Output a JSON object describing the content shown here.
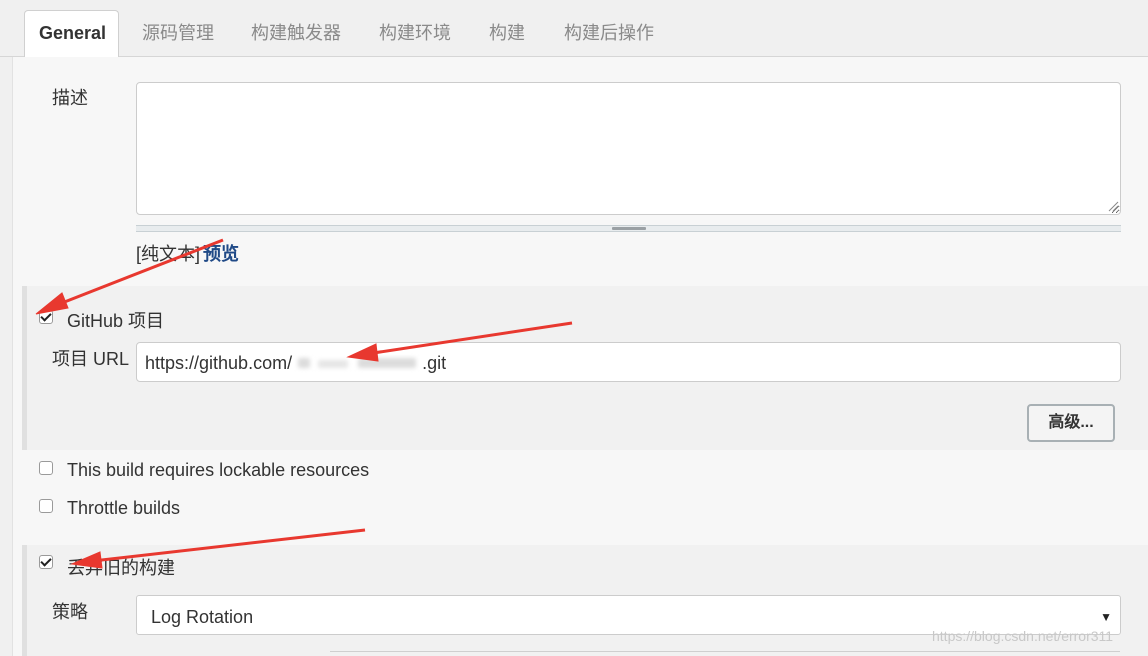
{
  "tabs": [
    {
      "label": "General",
      "active": true
    },
    {
      "label": "源码管理"
    },
    {
      "label": "构建触发器"
    },
    {
      "label": "构建环境"
    },
    {
      "label": "构建"
    },
    {
      "label": "构建后操作"
    }
  ],
  "description": {
    "label": "描述",
    "value": "",
    "plain_text": "[纯文本]",
    "preview": "预览"
  },
  "github": {
    "checkbox_label": "GitHub 项目",
    "checked": true,
    "url_label": "项目 URL",
    "url_prefix": "https://github.com/",
    "url_suffix": ".git",
    "advanced_button": "高级..."
  },
  "options": [
    {
      "label": "This build requires lockable resources",
      "checked": false
    },
    {
      "label": "Throttle builds",
      "checked": false
    },
    {
      "label": "丢弃旧的构建",
      "checked": true
    }
  ],
  "strategy": {
    "label": "策略",
    "selected": "Log Rotation",
    "arrow": "▼"
  },
  "watermark": "https://blog.csdn.net/error311",
  "annotation_color": "#e8382f"
}
